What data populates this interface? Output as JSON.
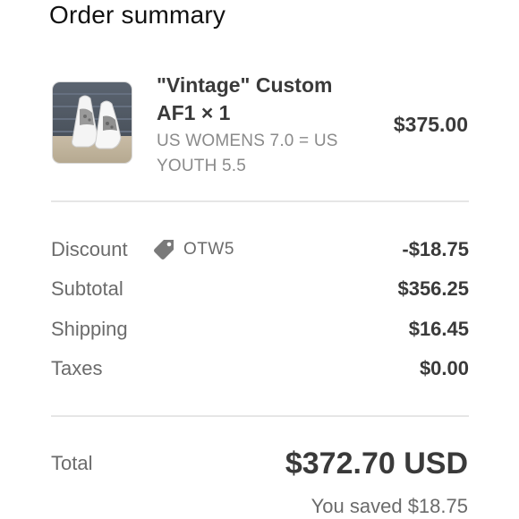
{
  "summary": {
    "title": "Order summary"
  },
  "item": {
    "name_line1": "\"Vintage\" Custom",
    "name_line2": "AF1 × 1",
    "variant_line1": "US WOMENS 7.0 = US",
    "variant_line2": "YOUTH 5.5",
    "price": "$375.00",
    "thumbnail_icon": "sneaker-thumbnail"
  },
  "discount": {
    "label": "Discount",
    "code": "OTW5",
    "icon": "tag-icon",
    "amount": "-$18.75"
  },
  "subtotal": {
    "label": "Subtotal",
    "amount": "$356.25"
  },
  "shipping": {
    "label": "Shipping",
    "amount": "$16.45"
  },
  "taxes": {
    "label": "Taxes",
    "amount": "$0.00"
  },
  "total": {
    "label": "Total",
    "amount": "$372.70 USD",
    "saved": "You saved $18.75"
  }
}
